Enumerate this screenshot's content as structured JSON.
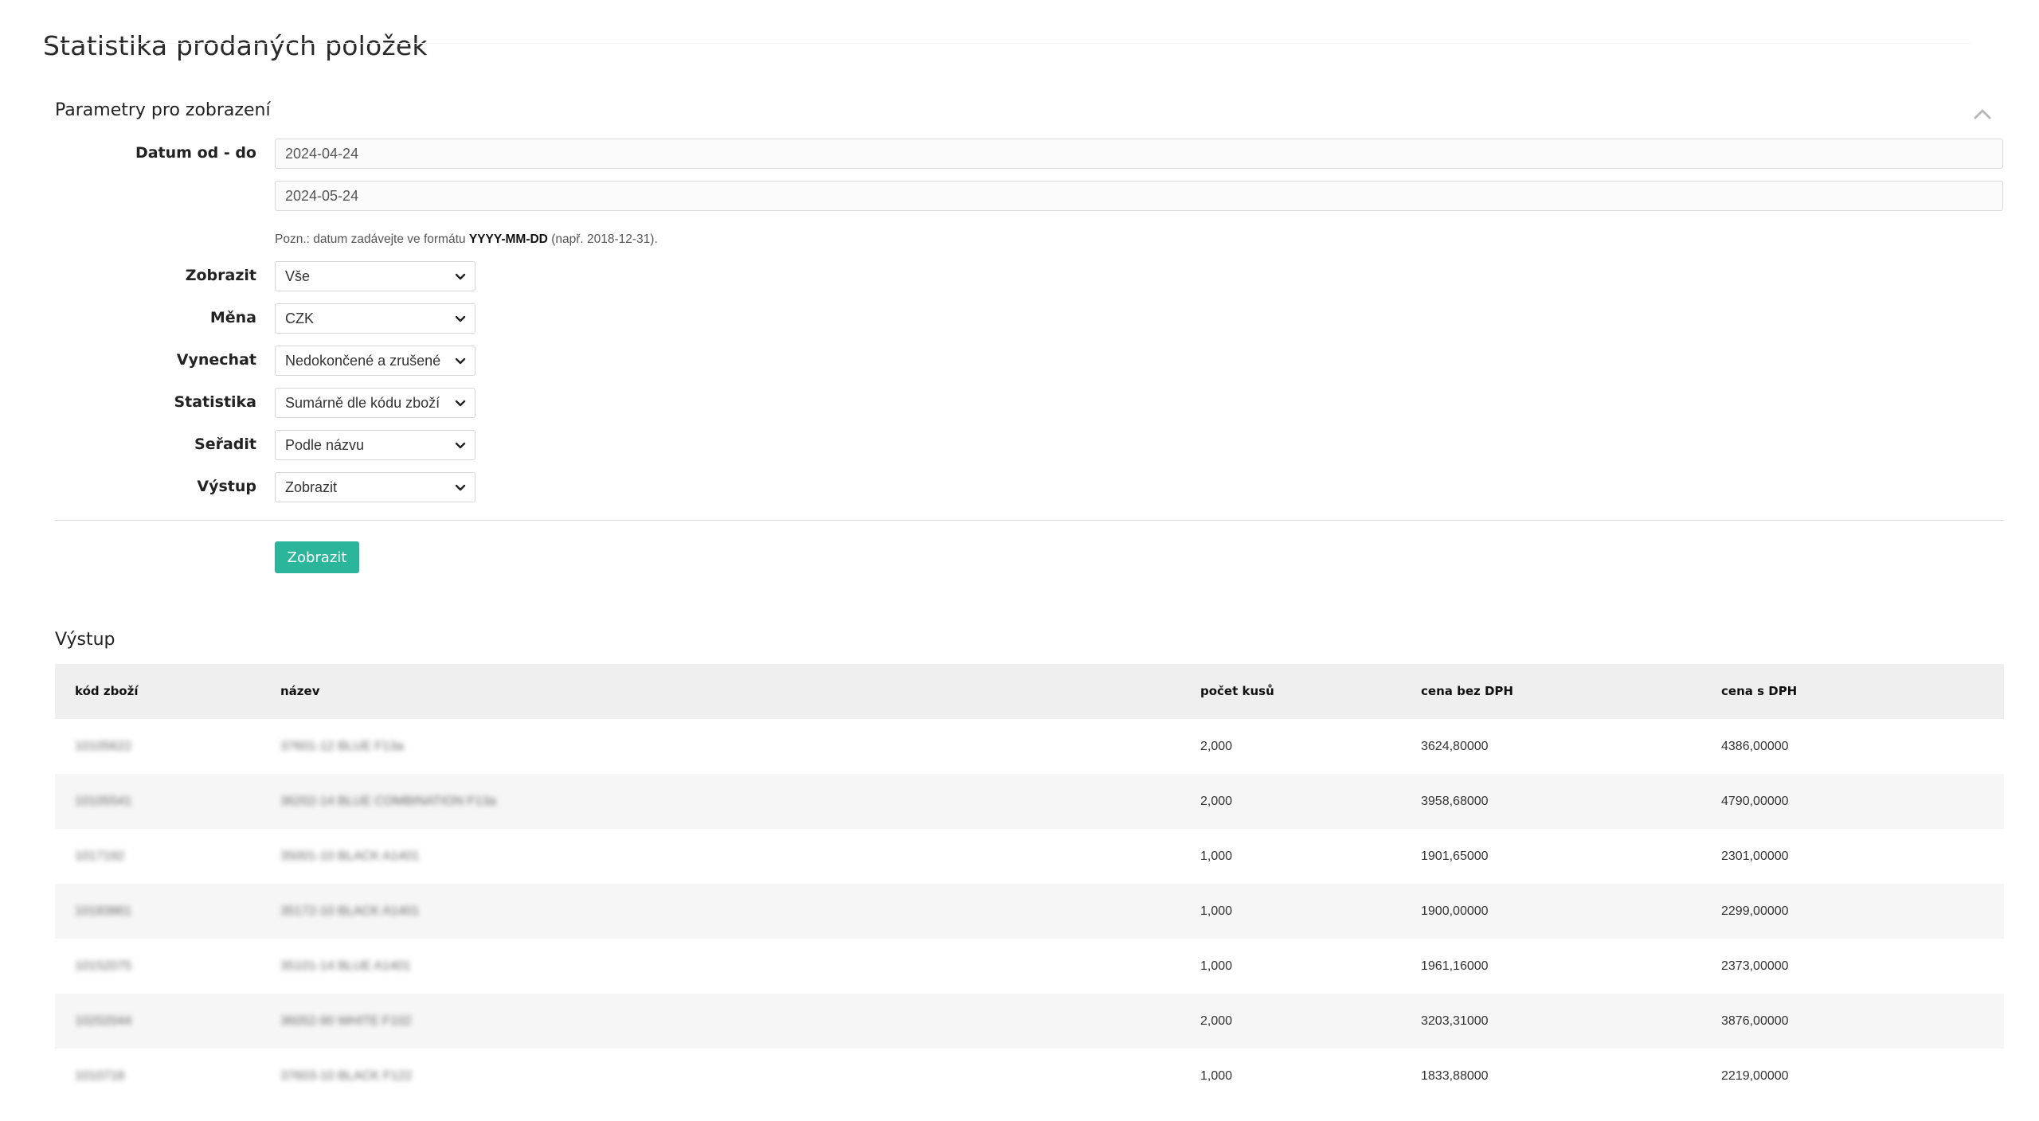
{
  "page": {
    "title": "Statistika prodaných položek"
  },
  "params": {
    "section_title": "Parametry pro zobrazení",
    "date_label": "Datum od - do",
    "date_from": "2024-04-24",
    "date_to": "2024-05-24",
    "hint_prefix": "Pozn.: datum zadávejte ve formátu",
    "hint_format": "YYYY-MM-DD",
    "hint_suffix": "(např. 2018-12-31).",
    "fields": [
      {
        "label": "Zobrazit",
        "value": "Vše"
      },
      {
        "label": "Měna",
        "value": "CZK"
      },
      {
        "label": "Vynechat",
        "value": "Nedokončené a zrušené"
      },
      {
        "label": "Statistika",
        "value": "Sumárně dle kódu zboží"
      },
      {
        "label": "Seřadit",
        "value": "Podle názvu"
      },
      {
        "label": "Výstup",
        "value": "Zobrazit"
      }
    ],
    "submit_label": "Zobrazit"
  },
  "output": {
    "title": "Výstup",
    "columns": [
      "kód zboží",
      "název",
      "počet kusů",
      "cena bez DPH",
      "cena s DPH"
    ],
    "rows": [
      {
        "code": "10105622",
        "name": "37601-12 BLUE F13a",
        "qty": "2,000",
        "price_ex": "3624,80000",
        "price_inc": "4386,00000"
      },
      {
        "code": "10105541",
        "name": "36202-14 BLUE COMBINATION F13a",
        "qty": "2,000",
        "price_ex": "3958,68000",
        "price_inc": "4790,00000"
      },
      {
        "code": "1017192",
        "name": "35001-10 BLACK A1401",
        "qty": "1,000",
        "price_ex": "1901,65000",
        "price_inc": "2301,00000"
      },
      {
        "code": "10183861",
        "name": "35172-10 BLACK A1401",
        "qty": "1,000",
        "price_ex": "1900,00000",
        "price_inc": "2299,00000"
      },
      {
        "code": "10152075",
        "name": "35101-14 BLUE A1401",
        "qty": "1,000",
        "price_ex": "1961,16000",
        "price_inc": "2373,00000"
      },
      {
        "code": "10202044",
        "name": "36052-90 WHITE F102",
        "qty": "2,000",
        "price_ex": "3203,31000",
        "price_inc": "3876,00000"
      },
      {
        "code": "1010718",
        "name": "37603-10 BLACK F122",
        "qty": "1,000",
        "price_ex": "1833,88000",
        "price_inc": "2219,00000"
      }
    ]
  }
}
